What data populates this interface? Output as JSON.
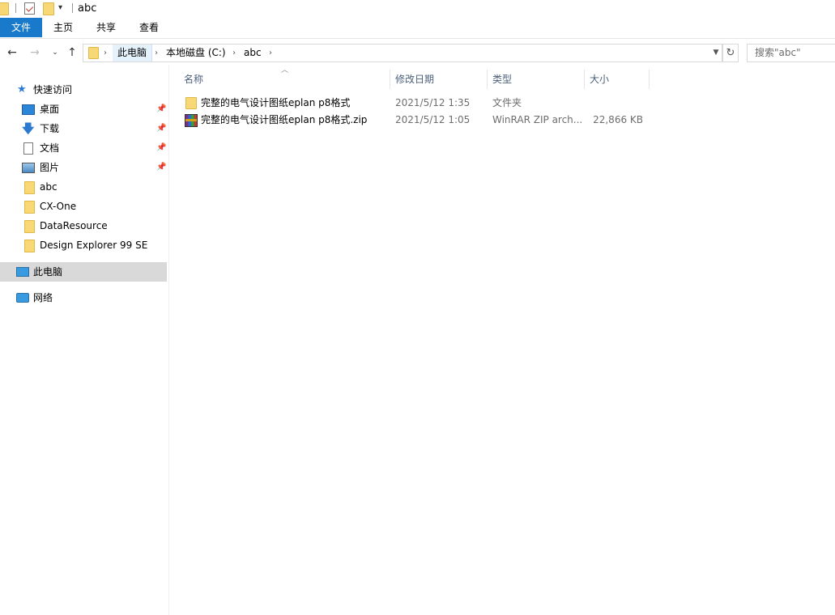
{
  "window": {
    "title": "abc"
  },
  "ribbon": {
    "tabs": [
      "文件",
      "主页",
      "共享",
      "查看"
    ]
  },
  "address": {
    "crumbs": [
      "此电脑",
      "本地磁盘 (C:)",
      "abc"
    ],
    "search_placeholder": "搜索\"abc\""
  },
  "nav": {
    "quick_access": "快速访问",
    "pinned": [
      {
        "label": "桌面",
        "icon": "desktop-icon"
      },
      {
        "label": "下载",
        "icon": "download-icon"
      },
      {
        "label": "文档",
        "icon": "document-icon"
      },
      {
        "label": "图片",
        "icon": "picture-icon"
      }
    ],
    "folders": [
      "abc",
      "CX-One",
      "DataResource",
      "Design Explorer 99 SE"
    ],
    "this_pc": "此电脑",
    "network": "网络"
  },
  "columns": [
    "名称",
    "修改日期",
    "类型",
    "大小"
  ],
  "files": [
    {
      "name": "完整的电气设计图纸eplan p8格式",
      "date": "2021/5/12 1:35",
      "type": "文件夹",
      "size": "",
      "icon": "folder-icon"
    },
    {
      "name": "完整的电气设计图纸eplan p8格式.zip",
      "date": "2021/5/12 1:05",
      "type": "WinRAR ZIP arch...",
      "size": "22,866 KB",
      "icon": "winrar-zip-icon"
    }
  ],
  "colors": {
    "file_tab": "#1979ca",
    "selected_nav": "#d9d9d9",
    "folder": "#f8d775"
  }
}
